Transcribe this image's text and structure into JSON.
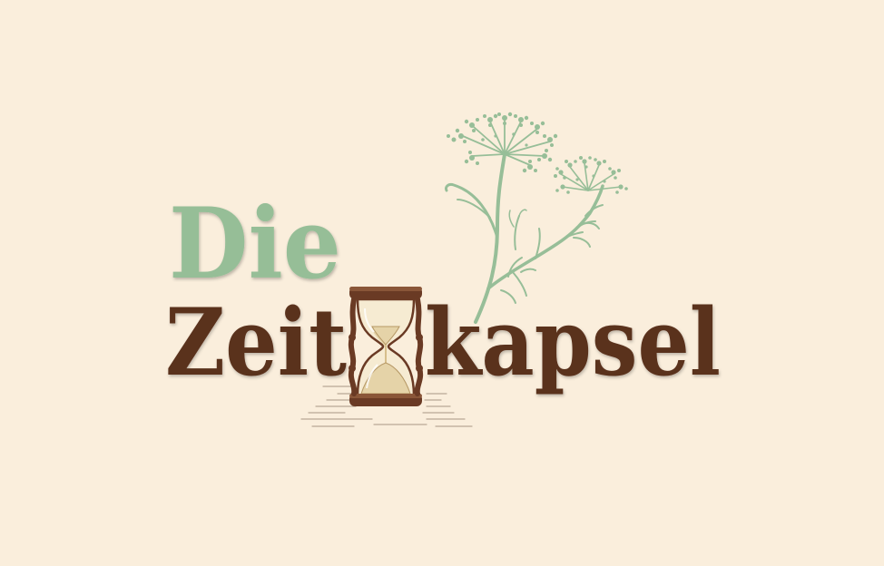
{
  "logo": {
    "line1": "Die",
    "line2_left": "Zeit",
    "line2_right": "kapsel"
  },
  "colors": {
    "background": "#FAEEDC",
    "green": "#96BE97",
    "brown": "#5A301D",
    "sand": "#E5D3A8",
    "wood": "#6A3A24"
  },
  "icons": [
    "hourglass-icon",
    "dill-plant-icon"
  ]
}
